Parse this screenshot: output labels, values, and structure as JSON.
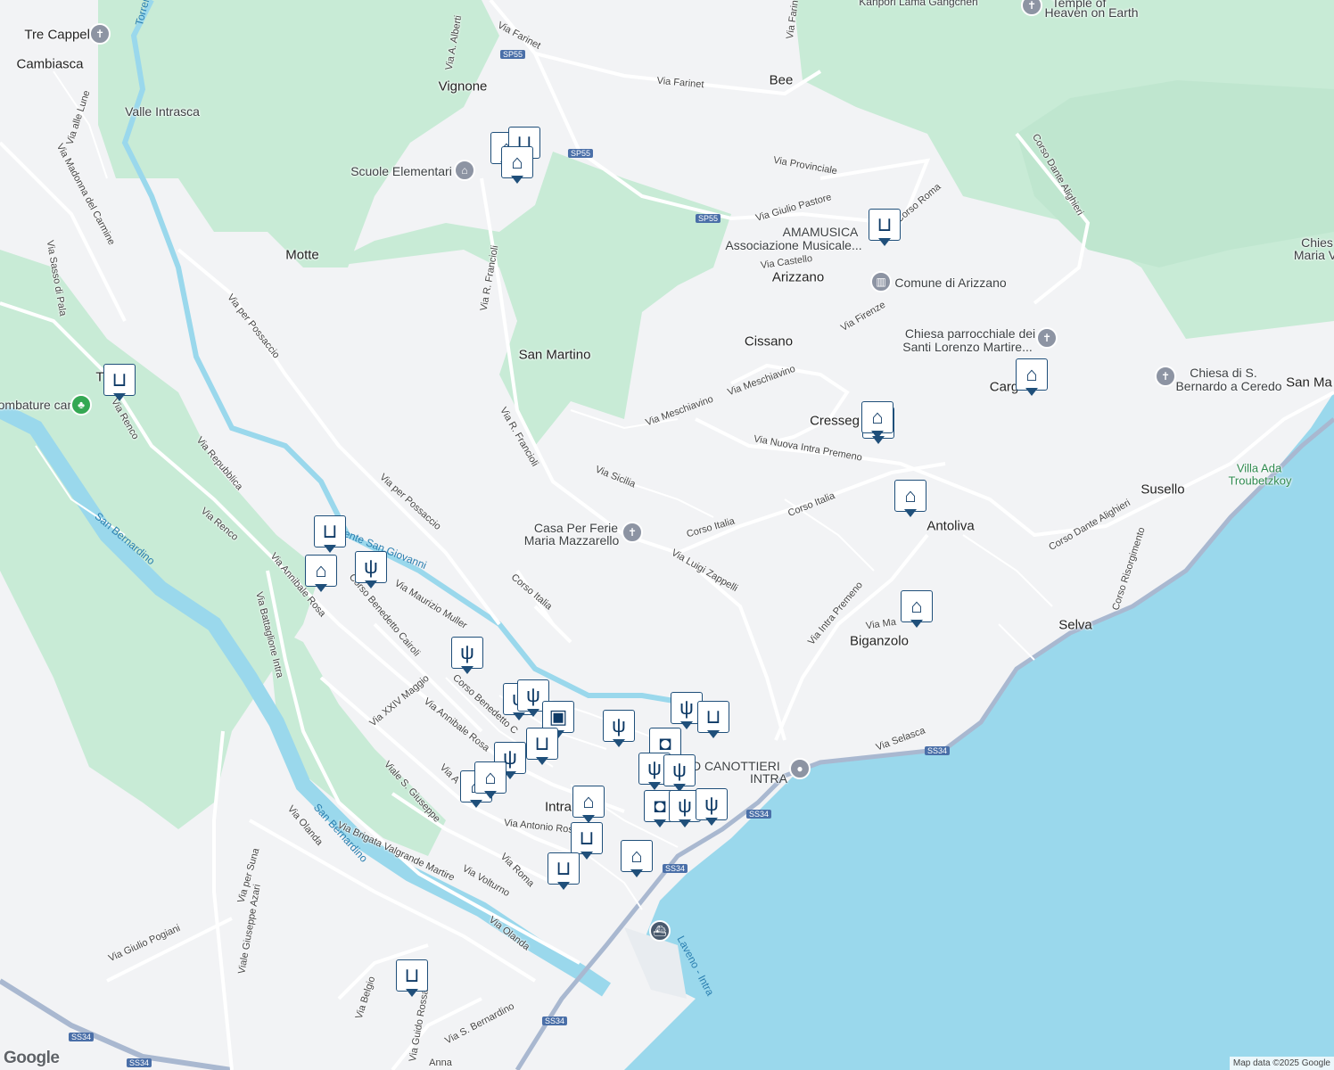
{
  "colors": {
    "land": "#f2f3f5",
    "park": "#c8ebd6",
    "water": "#9ad8ec",
    "river": "#9ad8ec",
    "road": "#ffffff",
    "highway": "#a9b8d0",
    "poi_border": "#1f4f7a",
    "poi_icon": "#0e3a66"
  },
  "labels": [
    {
      "id": "tre-cappelle",
      "text": "Tre Cappelle",
      "kind": "town"
    },
    {
      "id": "cambiasca",
      "text": "Cambiasca",
      "kind": "town"
    },
    {
      "id": "vignone",
      "text": "Vignone",
      "kind": "town"
    },
    {
      "id": "bee",
      "text": "Bee",
      "kind": "town"
    },
    {
      "id": "valle-intrasca",
      "text": "Valle Intrasca",
      "kind": "town"
    },
    {
      "id": "scuole",
      "text": "Scuole Elementari",
      "kind": "place"
    },
    {
      "id": "motte",
      "text": "Motte",
      "kind": "town"
    },
    {
      "id": "amamusica",
      "text": "AMAMUSICA",
      "kind": "place"
    },
    {
      "id": "assoc",
      "text": "Associazione Musicale...",
      "kind": "place"
    },
    {
      "id": "arizzano",
      "text": "Arizzano",
      "kind": "town"
    },
    {
      "id": "comune",
      "text": "Comune di Arizzano",
      "kind": "place"
    },
    {
      "id": "san-martino",
      "text": "San Martino",
      "kind": "town"
    },
    {
      "id": "cissano",
      "text": "Cissano",
      "kind": "town"
    },
    {
      "id": "chiesa-lor-1",
      "text": "Chiesa parrocchiale dei",
      "kind": "place"
    },
    {
      "id": "chiesa-lor-2",
      "text": "Santi Lorenzo Martire...",
      "kind": "place"
    },
    {
      "id": "chiesa-bern-1",
      "text": "Chiesa di S.",
      "kind": "place"
    },
    {
      "id": "chiesa-bern-2",
      "text": "Bernardo a Ceredo",
      "kind": "place"
    },
    {
      "id": "cargiago",
      "text": "Carg",
      "kind": "town"
    },
    {
      "id": "san-ma",
      "text": "San Ma",
      "kind": "town"
    },
    {
      "id": "chies-edge",
      "text": "Chies",
      "kind": "place"
    },
    {
      "id": "maria-edge",
      "text": "Maria V",
      "kind": "place"
    },
    {
      "id": "trobaso",
      "text": "T",
      "kind": "town"
    },
    {
      "id": "tosature",
      "text": "ombature cani",
      "kind": "place"
    },
    {
      "id": "cresseglio",
      "text": "Cresseg",
      "kind": "town"
    },
    {
      "id": "susello",
      "text": "Susello",
      "kind": "town"
    },
    {
      "id": "villa-ada-1",
      "text": "Villa Ada",
      "kind": "park"
    },
    {
      "id": "villa-ada-2",
      "text": "Troubetzkoy",
      "kind": "park"
    },
    {
      "id": "casa-ferie-1",
      "text": "Casa Per Ferie",
      "kind": "place"
    },
    {
      "id": "casa-ferie-2",
      "text": "Maria Mazzarello",
      "kind": "place"
    },
    {
      "id": "antoliva",
      "text": "Antoliva",
      "kind": "town"
    },
    {
      "id": "biganzolo",
      "text": "Biganzolo",
      "kind": "town"
    },
    {
      "id": "selva",
      "text": "Selva",
      "kind": "town"
    },
    {
      "id": "asd-1",
      "text": "ASD CANOTTIERI",
      "kind": "place"
    },
    {
      "id": "asd-2",
      "text": "INTRA",
      "kind": "place"
    },
    {
      "id": "intra",
      "text": "Intra",
      "kind": "town"
    },
    {
      "id": "temple-1",
      "text": "Temple of",
      "kind": "place"
    },
    {
      "id": "temple-2",
      "text": "Heaven on Earth",
      "kind": "place"
    },
    {
      "id": "kanpon",
      "text": "Kanpori Lama Gangchen",
      "kind": "place"
    },
    {
      "id": "torrente",
      "text": "Torren",
      "kind": "water"
    },
    {
      "id": "s-giovanni",
      "text": "ente San Giovanni",
      "kind": "water"
    },
    {
      "id": "s-bernardino-1",
      "text": "San Bernardino",
      "kind": "water"
    },
    {
      "id": "s-bernardino-2",
      "text": "San Bernardino",
      "kind": "water"
    },
    {
      "id": "laveno",
      "text": "Laveno - Intra",
      "kind": "water"
    }
  ],
  "streets": [
    {
      "id": "via-farinet-1",
      "text": "Via Farinet"
    },
    {
      "id": "via-farinet-2",
      "text": "Via Farinet"
    },
    {
      "id": "via-farin",
      "text": "Via Farin"
    },
    {
      "id": "via-alberti",
      "text": "Via A. Alberti"
    },
    {
      "id": "via-alle-lune",
      "text": "Via alle Lune"
    },
    {
      "id": "via-madonna",
      "text": "Via Madonna del Carmine"
    },
    {
      "id": "via-sasso",
      "text": "Via Sasso di Pala"
    },
    {
      "id": "via-provinciale",
      "text": "Via Provinciale"
    },
    {
      "id": "via-giulio-pastore",
      "text": "Via Giulio Pastore"
    },
    {
      "id": "corso-roma",
      "text": "Corso Roma"
    },
    {
      "id": "corso-dante-1",
      "text": "Corso Dante Alighieri"
    },
    {
      "id": "via-castello",
      "text": "Via Castello"
    },
    {
      "id": "via-firenze",
      "text": "Via Firenze"
    },
    {
      "id": "via-francioli-1",
      "text": "Via R. Francioli"
    },
    {
      "id": "via-francioli-2",
      "text": "Via R. Francioli"
    },
    {
      "id": "via-per-possaccio-1",
      "text": "Via per Possaccio"
    },
    {
      "id": "via-per-possaccio-2",
      "text": "Via per Possaccio"
    },
    {
      "id": "via-meschiavino-1",
      "text": "Via Meschiavino"
    },
    {
      "id": "via-meschiavino-2",
      "text": "Via Meschiavino"
    },
    {
      "id": "via-nuova",
      "text": "Via Nuova Intra Premeno"
    },
    {
      "id": "via-sicilia",
      "text": "Via Sicilia"
    },
    {
      "id": "corso-italia-1",
      "text": "Corso Italia"
    },
    {
      "id": "corso-italia-2",
      "text": "Corso Italia"
    },
    {
      "id": "corso-italia-3",
      "text": "Corso Italia"
    },
    {
      "id": "corso-dante-2",
      "text": "Corso Dante Alighieri"
    },
    {
      "id": "corso-risorgimento",
      "text": "Corso Risorgimento"
    },
    {
      "id": "via-renco-1",
      "text": "Via Renco"
    },
    {
      "id": "via-renco-2",
      "text": "Via Renco"
    },
    {
      "id": "via-repubblica",
      "text": "Via Repubblica"
    },
    {
      "id": "via-annibale-rosa-1",
      "text": "Via Annibale Rosa"
    },
    {
      "id": "via-annibale-rosa-2",
      "text": "Via Annibale Rosa"
    },
    {
      "id": "via-battaglione",
      "text": "Via Battaglione Intra"
    },
    {
      "id": "corso-cairoli-1",
      "text": "Corso Benedetto Cairoli"
    },
    {
      "id": "corso-cairoli-2",
      "text": "Corso Benedetto C"
    },
    {
      "id": "via-maurizio",
      "text": "Via Maurizio Muller"
    },
    {
      "id": "via-luigi",
      "text": "Via Luigi Zappelli"
    },
    {
      "id": "via-intra-premeno",
      "text": "Via Intra Premeno"
    },
    {
      "id": "via-ma",
      "text": "Via Ma"
    },
    {
      "id": "via-xxiv",
      "text": "Via XXIV Maggio"
    },
    {
      "id": "viale-s-giuseppe",
      "text": "Viale S. Giuseppe"
    },
    {
      "id": "via-antonio-rosmini",
      "text": "Via Antonio Rosmini"
    },
    {
      "id": "via-brigata",
      "text": "Via Brigata Valgrande Martire"
    },
    {
      "id": "via-roma",
      "text": "Via Roma"
    },
    {
      "id": "via-volturno",
      "text": "Via Volturno"
    },
    {
      "id": "via-olanda-1",
      "text": "Via Olanda"
    },
    {
      "id": "via-olanda-2",
      "text": "Via Olanda"
    },
    {
      "id": "via-per-suna",
      "text": "Via per Suna"
    },
    {
      "id": "viale-azari",
      "text": "Viale Giuseppe Azari"
    },
    {
      "id": "via-pogiani",
      "text": "Via Giulio Pogiani"
    },
    {
      "id": "via-belgio",
      "text": "Via Belgio"
    },
    {
      "id": "via-guido-rossa",
      "text": "Via Guido Rossa"
    },
    {
      "id": "via-s-bernardino",
      "text": "Via S. Bernardino"
    },
    {
      "id": "via-selasca",
      "text": "Via Selasca"
    },
    {
      "id": "via-a",
      "text": "Via A"
    },
    {
      "id": "via-sanna",
      "text": "Anna"
    }
  ],
  "shields": [
    {
      "id": "sp55-1",
      "text": "SP55"
    },
    {
      "id": "sp55-2",
      "text": "SP55"
    },
    {
      "id": "sp55-3",
      "text": "SP55"
    },
    {
      "id": "ss34-1",
      "text": "SS34"
    },
    {
      "id": "ss34-2",
      "text": "SS34"
    },
    {
      "id": "ss34-3",
      "text": "SS34"
    },
    {
      "id": "ss34-4",
      "text": "SS34"
    },
    {
      "id": "ss34-5",
      "text": "SS34"
    },
    {
      "id": "ss34-6",
      "text": "SS34"
    }
  ],
  "pois": [
    {
      "id": "poi-1",
      "icon": "school-icon"
    },
    {
      "id": "poi-2",
      "icon": "cart-icon"
    },
    {
      "id": "poi-3",
      "icon": "school-icon"
    },
    {
      "id": "poi-4",
      "icon": "cart-icon"
    },
    {
      "id": "poi-5",
      "icon": "cart-icon"
    },
    {
      "id": "poi-6",
      "icon": "school-icon"
    },
    {
      "id": "poi-7",
      "icon": "cart-icon"
    },
    {
      "id": "poi-8",
      "icon": "cart-icon"
    },
    {
      "id": "poi-9",
      "icon": "school-icon"
    },
    {
      "id": "poi-10",
      "icon": "cutlery-icon"
    },
    {
      "id": "poi-11",
      "icon": "school-icon"
    },
    {
      "id": "poi-12",
      "icon": "school-icon"
    },
    {
      "id": "poi-13",
      "icon": "cutlery-icon"
    },
    {
      "id": "poi-14",
      "icon": "school-icon"
    },
    {
      "id": "poi-15",
      "icon": "cutlery-icon"
    },
    {
      "id": "poi-16",
      "icon": "cart-icon"
    },
    {
      "id": "poi-17",
      "icon": "cutlery-icon"
    },
    {
      "id": "poi-18",
      "icon": "cutlery-icon"
    },
    {
      "id": "poi-19",
      "icon": "bag-icon"
    },
    {
      "id": "poi-20",
      "icon": "cutlery-icon"
    },
    {
      "id": "poi-21",
      "icon": "coffee-icon"
    },
    {
      "id": "poi-22",
      "icon": "cutlery-icon"
    },
    {
      "id": "poi-23",
      "icon": "cutlery-icon"
    },
    {
      "id": "poi-24",
      "icon": "school-icon"
    },
    {
      "id": "poi-25",
      "icon": "cutlery-icon"
    },
    {
      "id": "poi-26",
      "icon": "school-icon"
    },
    {
      "id": "poi-27",
      "icon": "school-icon"
    },
    {
      "id": "poi-28",
      "icon": "coffee-icon"
    },
    {
      "id": "poi-29",
      "icon": "cutlery-icon"
    },
    {
      "id": "poi-30",
      "icon": "cutlery-icon"
    },
    {
      "id": "poi-31",
      "icon": "cart-icon"
    },
    {
      "id": "poi-32",
      "icon": "cart-icon"
    },
    {
      "id": "poi-33",
      "icon": "school-icon"
    },
    {
      "id": "poi-34",
      "icon": "cart-icon"
    },
    {
      "id": "poi-35",
      "icon": "cart-icon"
    }
  ],
  "attribution": "Map data ©2025 Google",
  "logo": "Google"
}
